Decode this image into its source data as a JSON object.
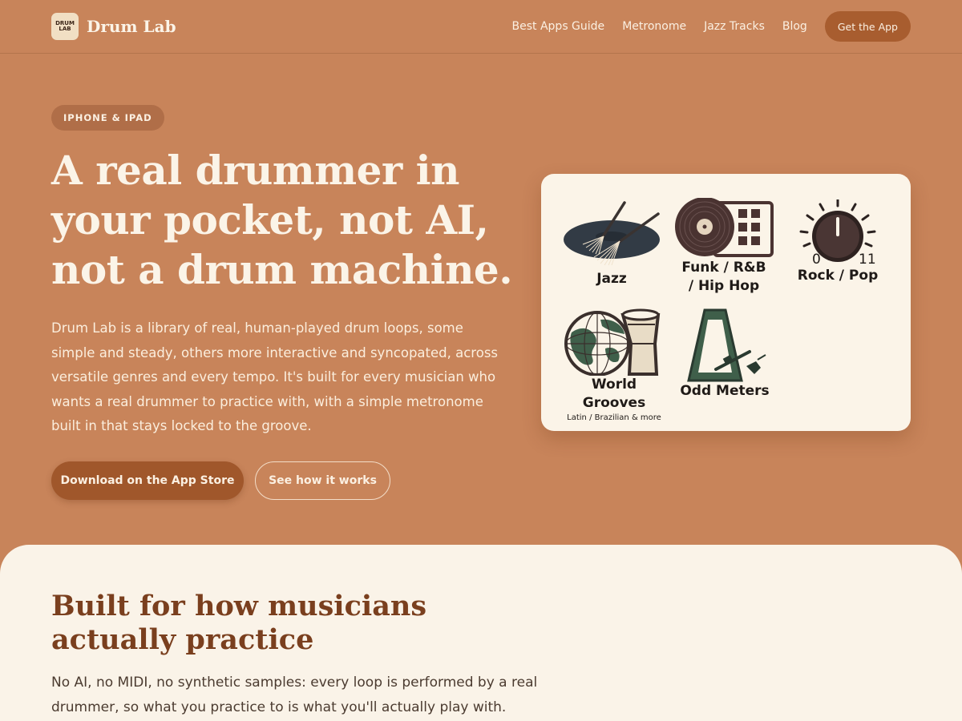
{
  "brand": {
    "name": "Drum Lab",
    "logo_line1": "DRUM",
    "logo_line2": "LAB"
  },
  "nav": {
    "links": [
      "Best Apps Guide",
      "Metronome",
      "Jazz Tracks",
      "Blog"
    ],
    "cta": "Get the App"
  },
  "hero": {
    "badge": "IPHONE & IPAD",
    "title": "A real drummer in your pocket, not AI, not a drum machine.",
    "description": "Drum Lab is a library of real, human-played drum loops, some simple and steady, others more interactive and syncopated, across versatile genres and every tempo. It's built for every musician who wants a real drummer to practice with, with a simple metronome built in that stays locked to the groove.",
    "primary_button": "Download on the App Store",
    "secondary_button": "See how it works"
  },
  "genres": {
    "jazz": "Jazz",
    "funk_line1": "Funk / R&B",
    "funk_line2": "/ Hip Hop",
    "rock": "Rock / Pop",
    "knob_min": "0",
    "knob_max": "11",
    "world": "World Grooves",
    "world_sub": "Latin / Brazilian & more",
    "odd": "Odd Meters"
  },
  "features": {
    "title": "Built for how musicians actually practice",
    "description": "No AI, no MIDI, no synthetic samples: every loop is performed by a real drummer, so what you practice to is what you'll actually play with."
  },
  "colors": {
    "hero_bg": "#c8845a",
    "accent_dark": "#a0572b",
    "cream": "#faf3e8",
    "heading_brown": "#7a3f1e"
  }
}
